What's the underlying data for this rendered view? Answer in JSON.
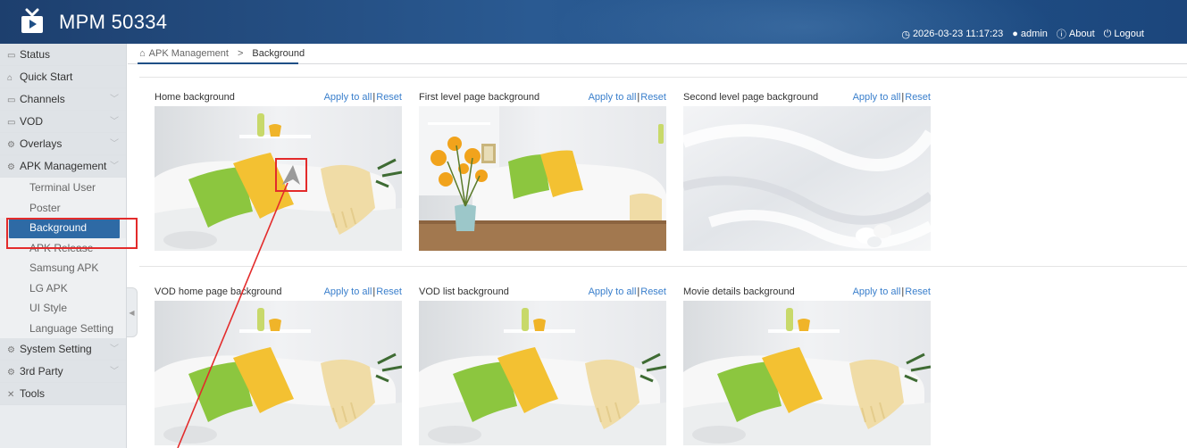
{
  "header": {
    "title": "MPM 50334",
    "datetime": "2026-03-23 11:17:23",
    "user": "admin",
    "about": "About",
    "logout": "Logout"
  },
  "sidebar": {
    "items": [
      {
        "label": "Status",
        "icon": "monitor-icon"
      },
      {
        "label": "Quick Start",
        "icon": "rocket-icon"
      },
      {
        "label": "Channels",
        "icon": "tv-icon"
      },
      {
        "label": "VOD",
        "icon": "screen-icon"
      },
      {
        "label": "Overlays",
        "icon": "gear-icon"
      },
      {
        "label": "APK Management",
        "icon": "gear-icon"
      }
    ],
    "sub_items": [
      "Terminal User",
      "Poster",
      "Background",
      "APK Release",
      "Samsung APK",
      "LG APK",
      "UI Style",
      "Language Setting"
    ],
    "bottom_items": [
      {
        "label": "System Setting",
        "icon": "gear-icon"
      },
      {
        "label": "3rd Party",
        "icon": "gear-icon"
      },
      {
        "label": "Tools",
        "icon": "tools-icon"
      }
    ],
    "active_sub": "Background"
  },
  "breadcrumb": {
    "parent": "APK Management",
    "separator": ">",
    "current": "Background"
  },
  "actions": {
    "apply": "Apply to all",
    "reset": "Reset"
  },
  "cards": [
    {
      "title": "Home background",
      "image": "living-room"
    },
    {
      "title": "First level page background",
      "image": "living-room-table"
    },
    {
      "title": "Second level page background",
      "image": "white-fabric"
    },
    {
      "title": "VOD home page background",
      "image": "living-room"
    },
    {
      "title": "VOD list background",
      "image": "living-room"
    },
    {
      "title": "Movie details background",
      "image": "living-room"
    }
  ],
  "colors": {
    "header": "#1f4f86",
    "accent": "#2e6aa5",
    "link": "#3a7fcc",
    "annotation": "#e32b2b"
  }
}
